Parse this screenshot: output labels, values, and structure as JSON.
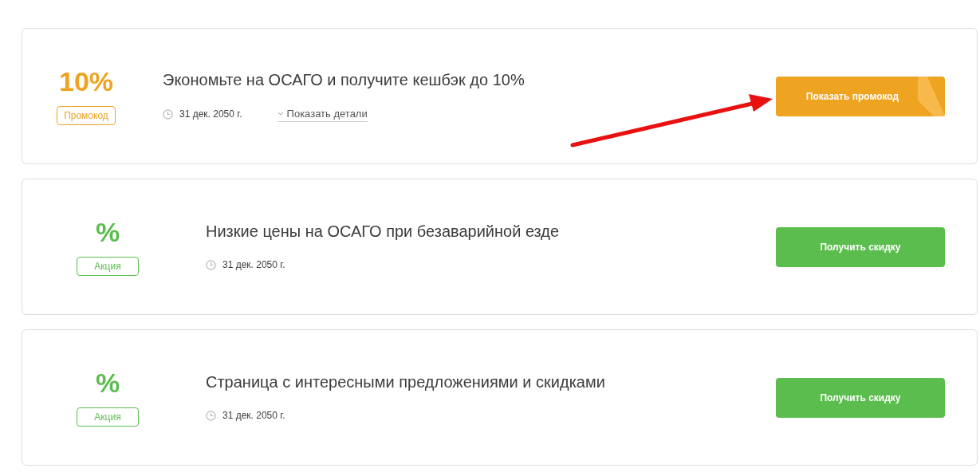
{
  "offers": [
    {
      "kind": "promocode",
      "value": "10%",
      "badge": "Промокод",
      "title": "Экономьте на ОСАГО и получите кешбэк до 10%",
      "date": "31 дек. 2050 г.",
      "details_link": "Показать детали",
      "button": "Показать промокод",
      "annotation_arrow": true
    },
    {
      "kind": "deal",
      "value": "%",
      "badge": "Акция",
      "title": "Низкие цены на ОСАГО при безаварийной езде",
      "date": "31 дек. 2050 г.",
      "button": "Получить скидку",
      "annotation_arrow": false
    },
    {
      "kind": "deal",
      "value": "%",
      "badge": "Акция",
      "title": "Страница с интересными предложениями и скидками",
      "date": "31 дек. 2050 г.",
      "button": "Получить скидку",
      "annotation_arrow": false
    }
  ]
}
